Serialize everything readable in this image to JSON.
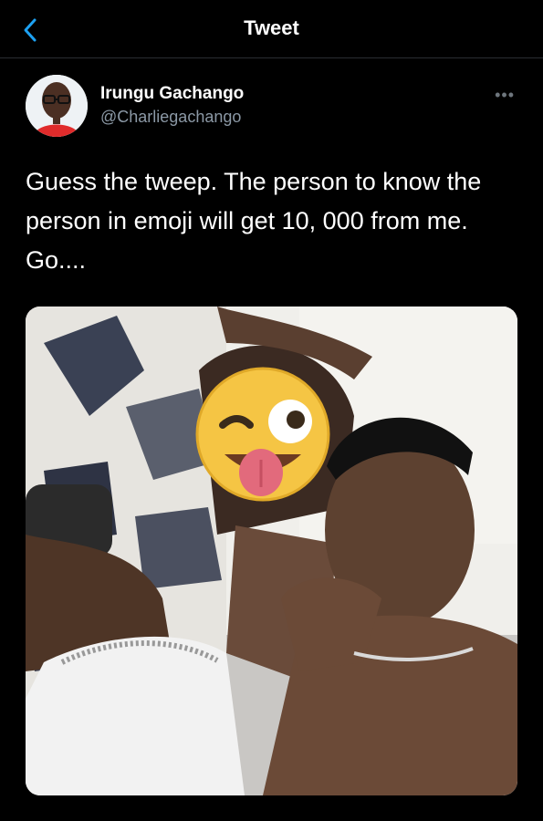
{
  "header": {
    "title": "Tweet",
    "back_icon": "chevron-left-icon"
  },
  "tweet": {
    "display_name": "Irungu Gachango",
    "handle": "@Charliegachango",
    "more_icon": "ellipsis-icon",
    "text": "Guess the tweep. The person to know the person in emoji will get 10, 000 from me. Go....",
    "media": {
      "type": "photo",
      "emoji": "winking-face-with-tongue"
    }
  },
  "colors": {
    "background": "#000000",
    "accent": "#1DA1F2",
    "secondary_text": "#8B98A5"
  }
}
